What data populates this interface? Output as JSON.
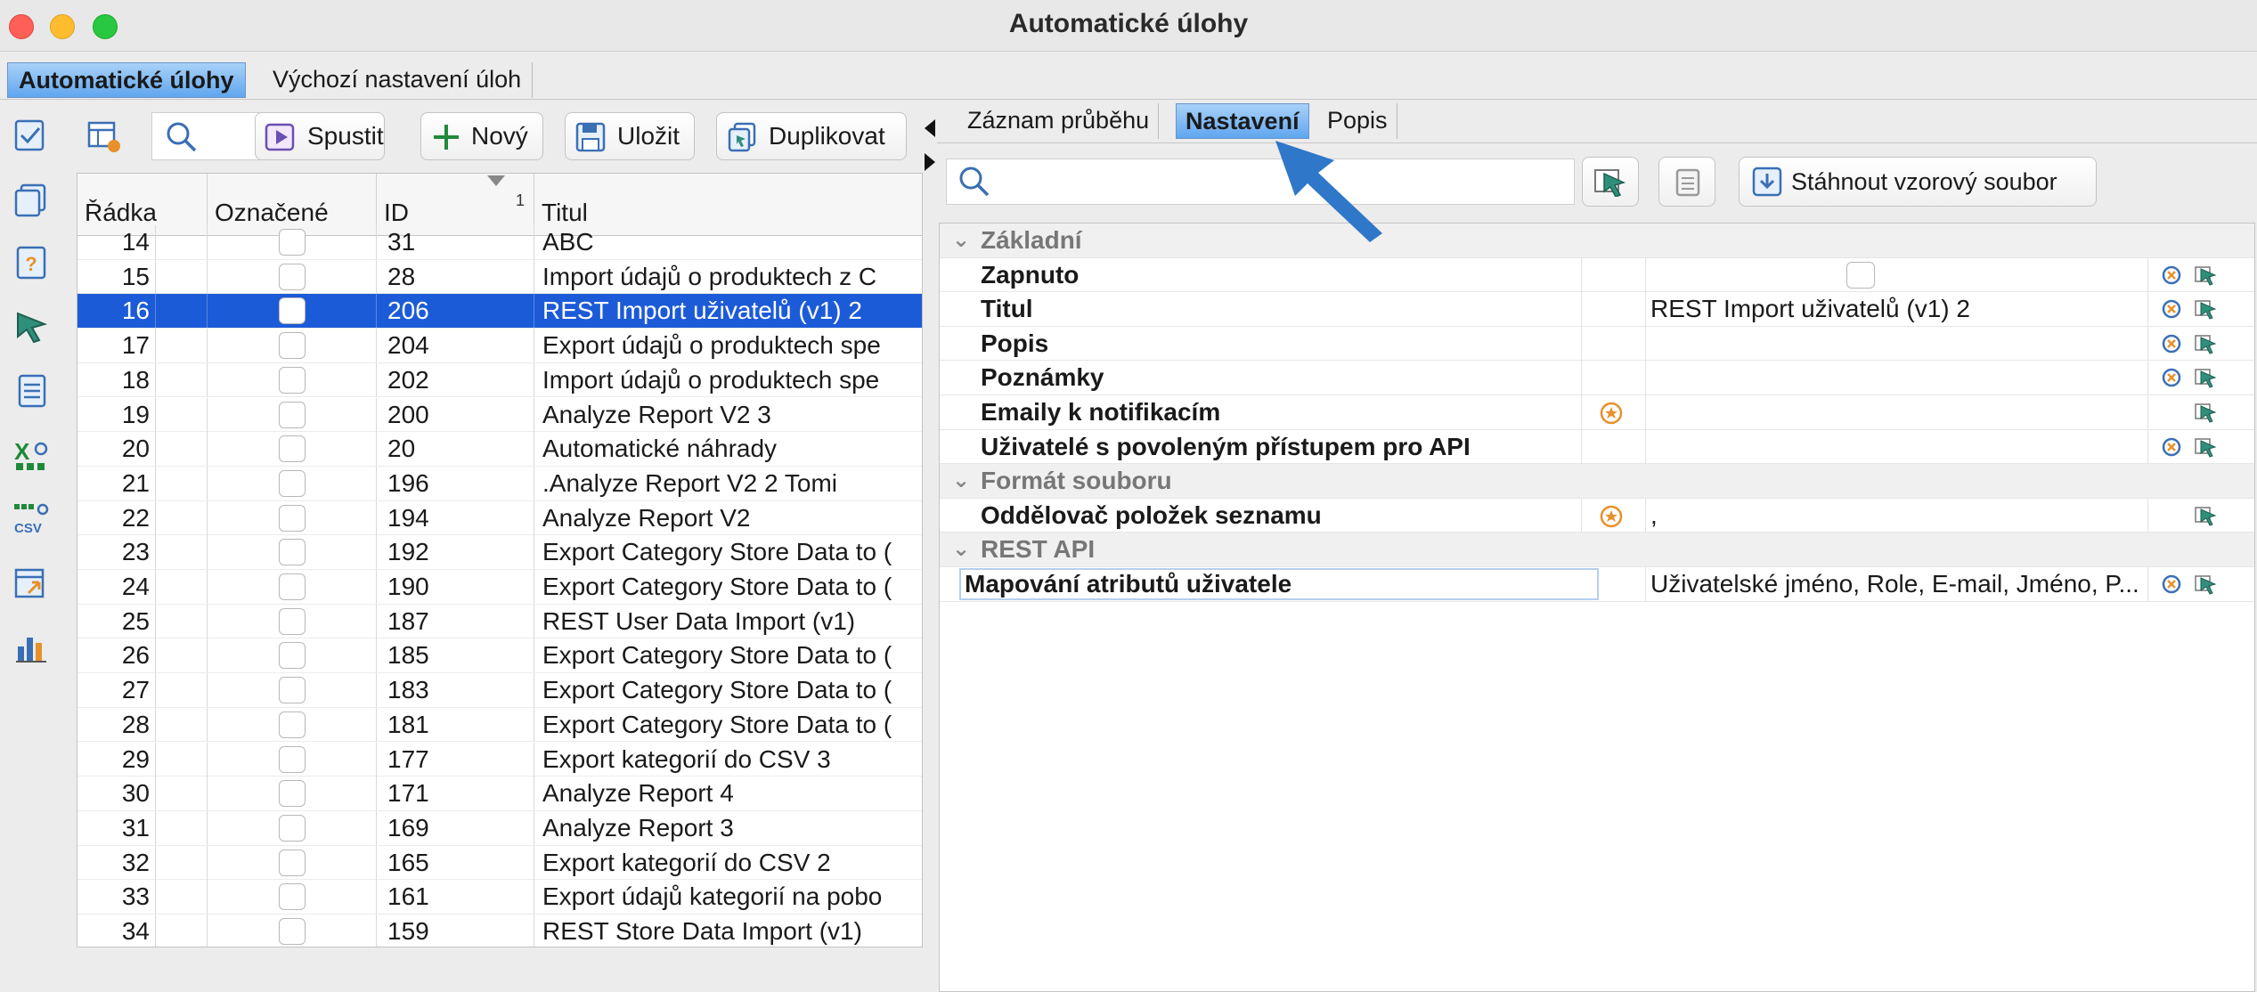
{
  "window": {
    "title": "Automatické úlohy"
  },
  "main_tabs": [
    {
      "label": "Automatické úlohy",
      "active": true
    },
    {
      "label": "Výchozí nastavení úloh",
      "active": false
    }
  ],
  "sidebar_icons": [
    "tasks-checklist-icon",
    "copy-icon",
    "help-document-icon",
    "select-cursor-icon",
    "list-document-icon",
    "excel-export-icon",
    "csv-export-icon",
    "import-table-icon",
    "bar-chart-icon"
  ],
  "toolbar": {
    "run_label": "Spustit",
    "new_label": "Nový",
    "save_label": "Uložit",
    "duplicate_label": "Duplikovat"
  },
  "table": {
    "columns": [
      "Řádka",
      "Označené",
      "ID",
      "Titul"
    ],
    "sort_column_index": "1",
    "rows": [
      {
        "row": "14",
        "id": "31",
        "title": "ABC"
      },
      {
        "row": "15",
        "id": "28",
        "title": "Import údajů o produktech z C"
      },
      {
        "row": "16",
        "id": "206",
        "title": "REST Import uživatelů (v1) 2",
        "selected": true
      },
      {
        "row": "17",
        "id": "204",
        "title": "Export údajů o produktech spe"
      },
      {
        "row": "18",
        "id": "202",
        "title": "Import údajů o produktech spe"
      },
      {
        "row": "19",
        "id": "200",
        "title": "Analyze Report V2 3"
      },
      {
        "row": "20",
        "id": "20",
        "title": "Automatické náhrady"
      },
      {
        "row": "21",
        "id": "196",
        "title": ".Analyze Report V2 2 Tomi"
      },
      {
        "row": "22",
        "id": "194",
        "title": "Analyze Report V2"
      },
      {
        "row": "23",
        "id": "192",
        "title": "Export Category Store Data to ("
      },
      {
        "row": "24",
        "id": "190",
        "title": "Export Category Store Data to ("
      },
      {
        "row": "25",
        "id": "187",
        "title": "REST User Data Import (v1)"
      },
      {
        "row": "26",
        "id": "185",
        "title": "Export Category Store Data to ("
      },
      {
        "row": "27",
        "id": "183",
        "title": "Export Category Store Data to ("
      },
      {
        "row": "28",
        "id": "181",
        "title": "Export Category Store Data to ("
      },
      {
        "row": "29",
        "id": "177",
        "title": "Export kategorií do CSV 3"
      },
      {
        "row": "30",
        "id": "171",
        "title": "Analyze Report 4"
      },
      {
        "row": "31",
        "id": "169",
        "title": "Analyze Report 3"
      },
      {
        "row": "32",
        "id": "165",
        "title": "Export kategorií do CSV 2"
      },
      {
        "row": "33",
        "id": "161",
        "title": "Export údajů kategorií na pobo"
      },
      {
        "row": "34",
        "id": "159",
        "title": "REST Store Data Import (v1)"
      }
    ]
  },
  "right_tabs": [
    {
      "label": "Záznam průběhu",
      "active": false
    },
    {
      "label": "Nastavení",
      "active": true
    },
    {
      "label": "Popis",
      "active": false
    }
  ],
  "right_toolbar": {
    "download_label": "Stáhnout vzorový soubor"
  },
  "properties": {
    "cat_basic": "Základní",
    "enabled": "Zapnuto",
    "title_label": "Titul",
    "title_value": "REST Import uživatelů (v1) 2",
    "description": "Popis",
    "notes": "Poznámky",
    "emails": "Emaily k notifikacím",
    "api_users": "Uživatelé s povoleným přístupem pro API",
    "cat_file_format": "Formát souboru",
    "list_separator": "Oddělovač položek seznamu",
    "list_separator_value": ",",
    "cat_rest_api": "REST API",
    "attr_mapping": "Mapování atributů uživatele",
    "attr_mapping_value": "Uživatelské jméno, Role, E-mail, Jméno, P..."
  },
  "colors": {
    "selection": "#1c5bd8",
    "tab_active": "#5fa6ee",
    "callout_arrow": "#2f77c8",
    "accent_orange": "#e8902a"
  }
}
